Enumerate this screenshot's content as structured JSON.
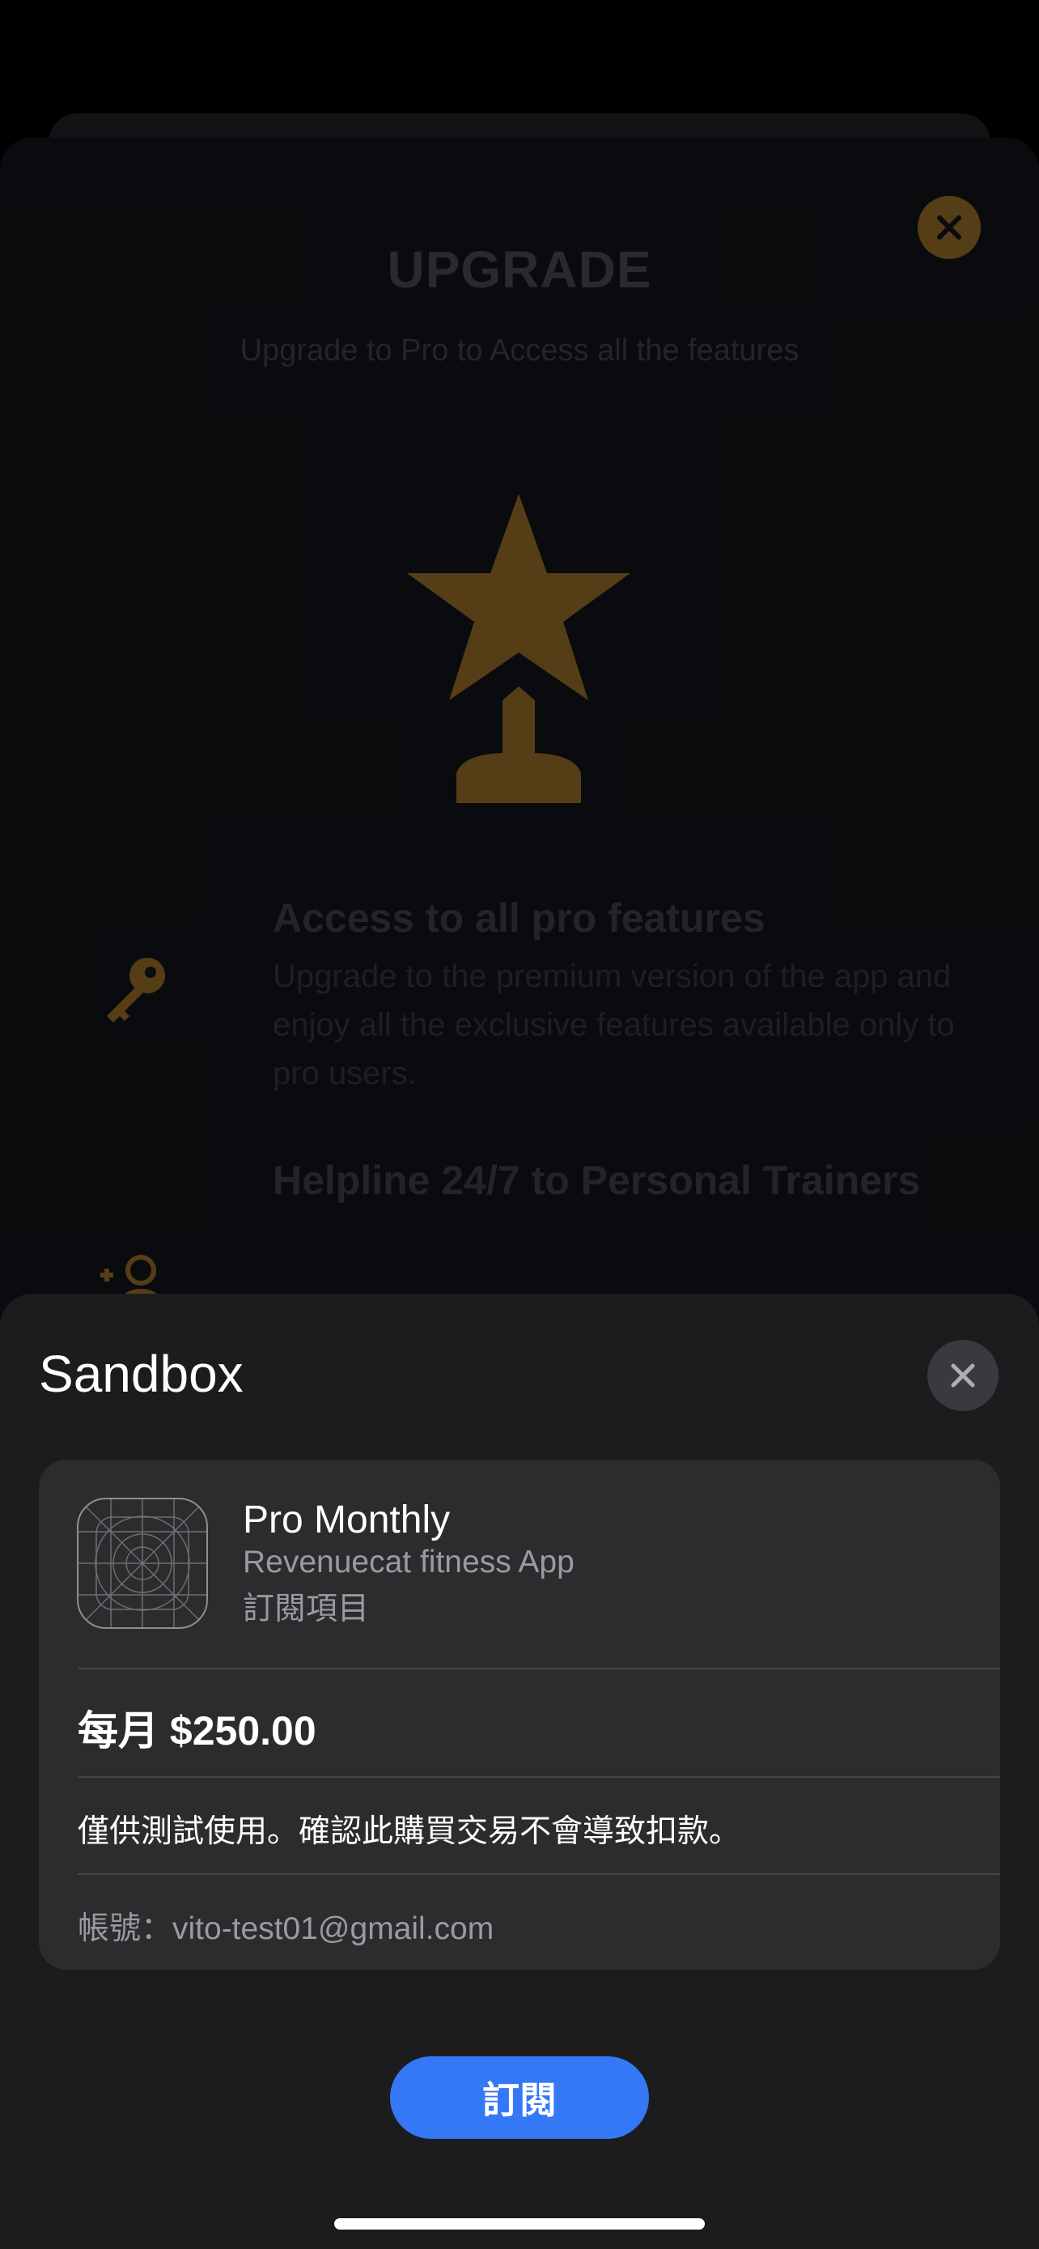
{
  "background_app": {
    "title": "UPGRADE",
    "subtitle": "Upgrade to Pro to Access all the features",
    "features": [
      {
        "icon": "key-icon",
        "title": "Access to all pro features",
        "description": "Upgrade to the premium version of the app and enjoy all the exclusive features available only to pro users."
      },
      {
        "icon": "add-person-icon",
        "title": "Helpline 24/7 to Personal Trainers",
        "description": ""
      }
    ],
    "accent_color": "#E0A33A"
  },
  "sheet": {
    "title": "Sandbox",
    "product": {
      "name": "Pro Monthly",
      "app": "Revenuecat fitness App",
      "type": "訂閱項目"
    },
    "price": "每月 $250.00",
    "note": "僅供測試使用。確認此購買交易不會導致扣款。",
    "account": "帳號：vito-test01@gmail.com",
    "subscribe_label": "訂閱",
    "button_color": "#3478F6"
  }
}
